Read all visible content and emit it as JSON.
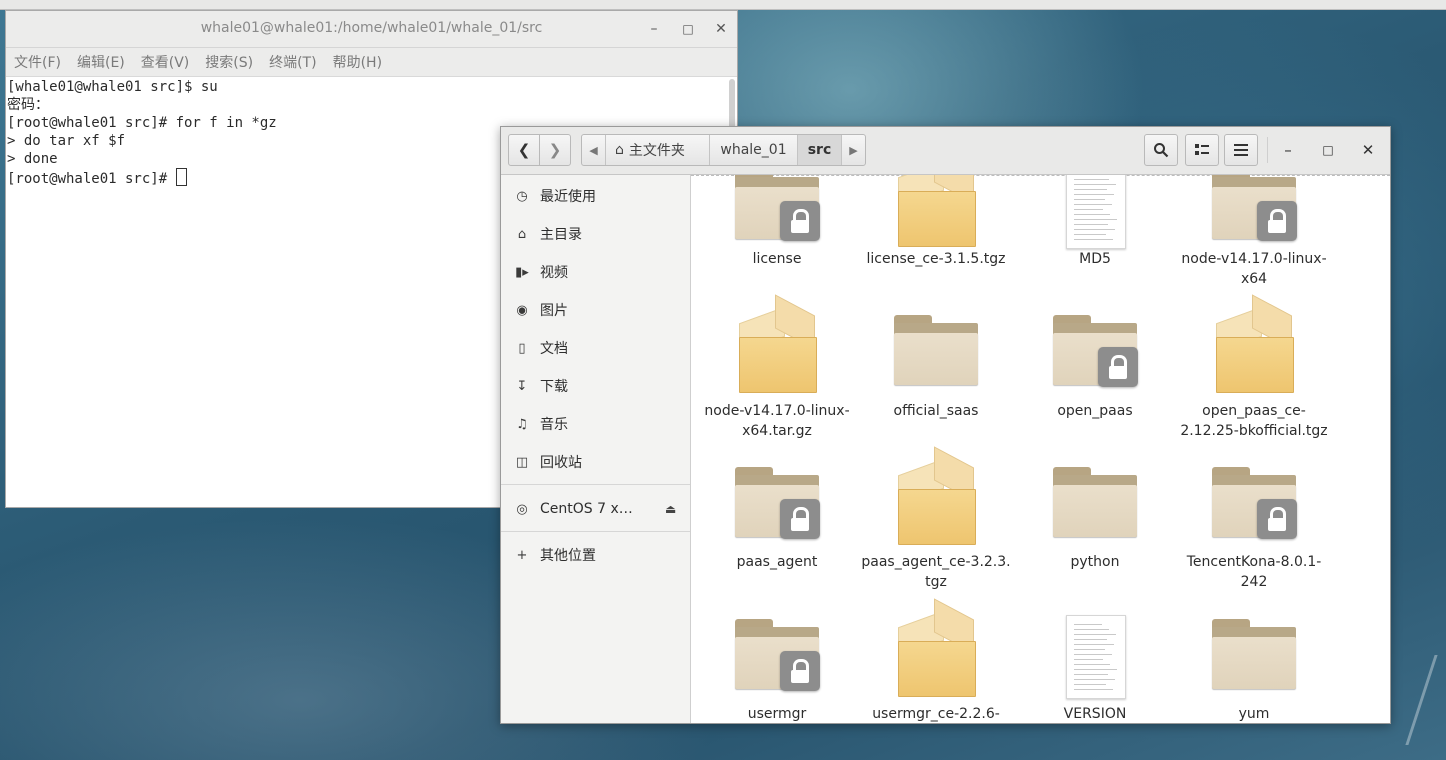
{
  "terminal": {
    "title": "whale01@whale01:/home/whale01/whale_01/src",
    "menu": [
      "文件(F)",
      "编辑(E)",
      "查看(V)",
      "搜索(S)",
      "终端(T)",
      "帮助(H)"
    ],
    "lines": [
      "[whale01@whale01 src]$ su",
      "密码：",
      "[root@whale01 src]# for f in *gz",
      "> do tar xf $f",
      "> done",
      "[root@whale01 src]# "
    ],
    "controls": {
      "minimize": "–",
      "maximize": "□",
      "close": "✕"
    }
  },
  "files": {
    "path": {
      "home_label": "主文件夹",
      "segments": [
        "whale_01",
        "src"
      ],
      "active": "src"
    },
    "icons": {
      "back": "chevron-left-icon",
      "forward": "chevron-right-icon",
      "search": "search-icon",
      "view": "list-view-icon",
      "menu": "hamburger-menu-icon"
    },
    "sidebar": {
      "items": [
        {
          "label": "最近使用",
          "icon": "clock-icon"
        },
        {
          "label": "主目录",
          "icon": "home-icon"
        },
        {
          "label": "视频",
          "icon": "video-icon"
        },
        {
          "label": "图片",
          "icon": "camera-icon"
        },
        {
          "label": "文档",
          "icon": "document-icon"
        },
        {
          "label": "下载",
          "icon": "download-icon"
        },
        {
          "label": "音乐",
          "icon": "music-icon"
        },
        {
          "label": "回收站",
          "icon": "trash-icon"
        }
      ],
      "device": {
        "label": "CentOS 7 x…",
        "icon": "disc-icon",
        "eject": "eject-icon"
      },
      "other": {
        "label": "其他位置",
        "icon": "plus-icon"
      }
    },
    "items": [
      {
        "name": "license",
        "kind": "folder",
        "locked": true
      },
      {
        "name": "license_ce-3.1.5.tgz",
        "kind": "archive",
        "locked": false
      },
      {
        "name": "MD5",
        "kind": "text",
        "locked": false
      },
      {
        "name": "node-v14.17.0-linux-x64",
        "kind": "folder",
        "locked": true
      },
      {
        "name": "node-v14.17.0-linux-x64.tar.gz",
        "kind": "archive",
        "locked": false
      },
      {
        "name": "official_saas",
        "kind": "folder",
        "locked": false
      },
      {
        "name": "open_paas",
        "kind": "folder",
        "locked": true
      },
      {
        "name": "open_paas_ce-2.12.25-bkofficial.tgz",
        "kind": "archive",
        "locked": false
      },
      {
        "name": "paas_agent",
        "kind": "folder",
        "locked": true
      },
      {
        "name": "paas_agent_ce-3.2.3.tgz",
        "kind": "archive",
        "locked": false
      },
      {
        "name": "python",
        "kind": "folder",
        "locked": false
      },
      {
        "name": "TencentKona-8.0.1-242",
        "kind": "folder",
        "locked": true
      },
      {
        "name": "usermgr",
        "kind": "folder",
        "locked": true
      },
      {
        "name": "usermgr_ce-2.2.6-",
        "kind": "archive",
        "locked": false
      },
      {
        "name": "VERSION",
        "kind": "text",
        "locked": false
      },
      {
        "name": "yum",
        "kind": "folder",
        "locked": false
      }
    ],
    "item_labels_wrapped": [
      [
        "license"
      ],
      [
        "license_ce-3.1.5.tgz"
      ],
      [
        "MD5"
      ],
      [
        "node-v14.17.0-linux-",
        "x64"
      ],
      [
        "node-v14.17.0-linux-",
        "x64.tar.gz"
      ],
      [
        "official_saas"
      ],
      [
        "open_paas"
      ],
      [
        "open_paas_ce-",
        "2.12.25-bkofficial.tgz"
      ],
      [
        "paas_agent"
      ],
      [
        "paas_agent_ce-3.2.3.",
        "tgz"
      ],
      [
        "python"
      ],
      [
        "TencentKona-8.0.1-",
        "242"
      ],
      [
        "usermgr"
      ],
      [
        "usermgr_ce-2.2.6-"
      ],
      [
        "VERSION"
      ],
      [
        "yum"
      ]
    ]
  }
}
